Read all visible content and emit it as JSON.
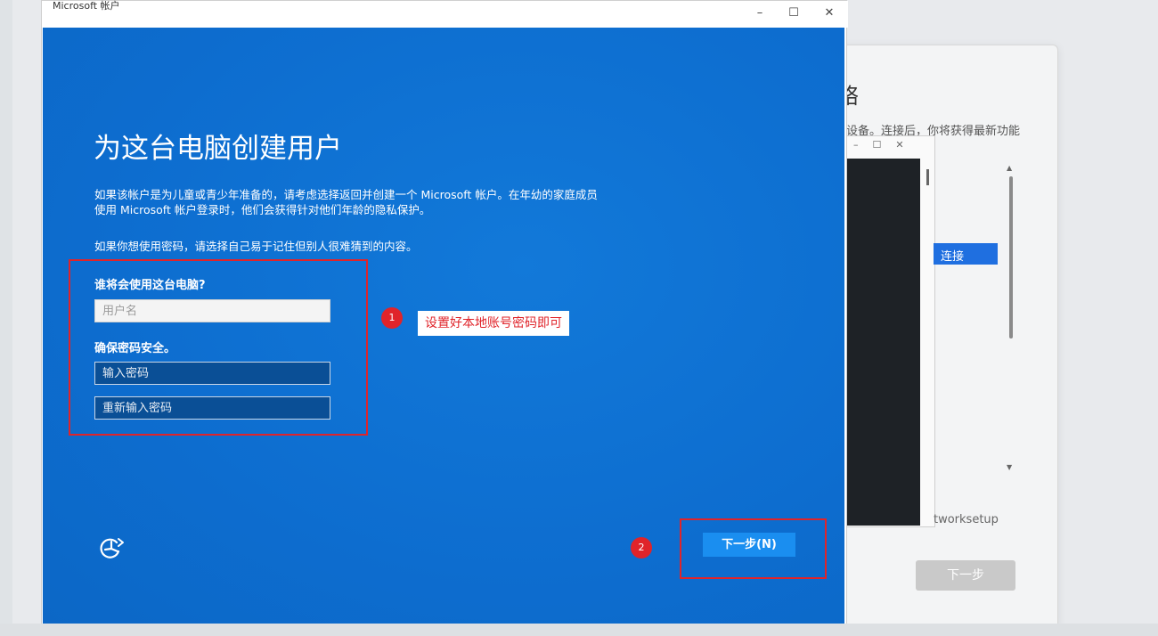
{
  "main_window": {
    "title": "Microsoft 帐户",
    "controls": {
      "minimize": "–",
      "maximize": "☐",
      "close": "✕"
    },
    "heading": "为这台电脑创建用户",
    "description_line1": "如果该帐户是为儿童或青少年准备的，请考虑选择返回并创建一个 Microsoft 帐户。在年幼的家庭成员",
    "description_line2": "使用 Microsoft 帐户登录时，他们会获得针对他们年龄的隐私保护。",
    "description_line3": "如果你想使用密码，请选择自己易于记住但别人很难猜到的内容。",
    "who_label": "谁将会使用这台电脑?",
    "username_placeholder": "用户名",
    "secure_label": "确保密码安全。",
    "password_placeholder": "输入密码",
    "confirm_placeholder": "重新输入密码",
    "next_button": "下一步(N)",
    "accessibility_icon": "accessibility-icon"
  },
  "annotations": {
    "badge_1": "1",
    "badge_2": "2",
    "callout_text": "设置好本地账号密码即可",
    "highlight_color": "#e0242a"
  },
  "background_window": {
    "title_fragment": "络",
    "description": "设备。连接后，你将获得最新功能",
    "connect_button": "连接",
    "text_fragment": "tworksetup",
    "next_button": "下一步",
    "inner_controls": "–☐✕",
    "scroll_up": "▲",
    "scroll_down": "▼"
  },
  "colors": {
    "oobe_blue": "#0d6fd1",
    "next_button_blue": "#1a8ef0",
    "password_field_bg": "#0a4f96"
  }
}
